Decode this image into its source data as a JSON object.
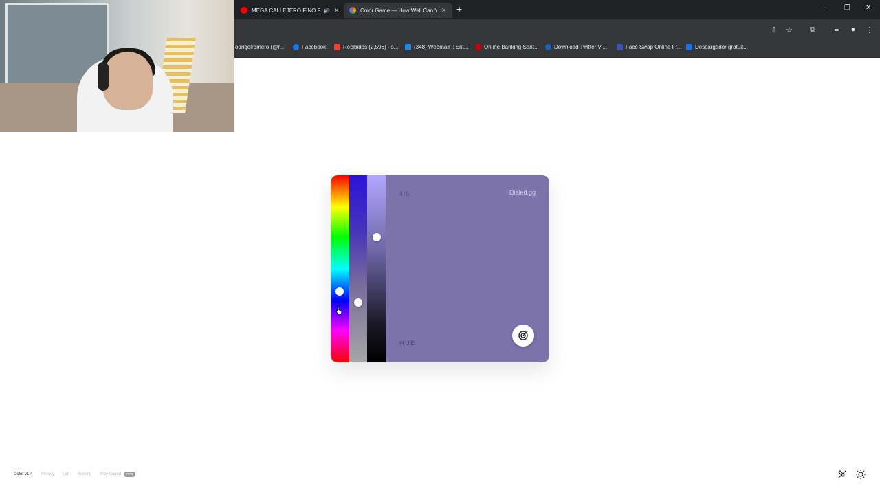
{
  "browser": {
    "tabs": [
      {
        "title": "MEGA CALLEJERO FINO RK",
        "favicon_color": "#ff0000",
        "audio": true
      },
      {
        "title": "Color Game — How Well Can You",
        "favicon_color": "#f4b400",
        "active": true
      }
    ],
    "new_tab": "+",
    "window_controls": [
      "–",
      "❐",
      "✕"
    ],
    "bookmarks": [
      {
        "label": "odrigolromero (@r...",
        "icon_color": "#888888"
      },
      {
        "label": "Facebook",
        "icon_color": "#1877f2"
      },
      {
        "label": "Recibidos (2,596) - s...",
        "icon_color": "#ea4335"
      },
      {
        "label": "(348) Webmail :: Ent...",
        "icon_color": "#1e88e5"
      },
      {
        "label": "Online Banking Sant...",
        "icon_color": "#cc0000"
      },
      {
        "label": "Download Twitter Vi...",
        "icon_color": "#1565c0"
      },
      {
        "label": "Face Swap Online Fr...",
        "icon_color": "#3f51b5"
      },
      {
        "label": "Descargador gratuit...",
        "icon_color": "#1a73e8"
      }
    ]
  },
  "game": {
    "progress": "4/5",
    "brand": "Dialed.gg",
    "mode_label": "HUE",
    "target_color": "#7c73ab",
    "hue_level": 0.62,
    "saturation_level": 0.68,
    "lightness_level": 0.33
  },
  "footer": {
    "version": "Color v1.4",
    "links": [
      "Privacy",
      "Lab",
      "Scoring",
      "Play Sound"
    ],
    "badge": "new"
  },
  "icons": {
    "submit": "target-icon",
    "sound": "mute-icon",
    "theme": "sun-icon"
  }
}
